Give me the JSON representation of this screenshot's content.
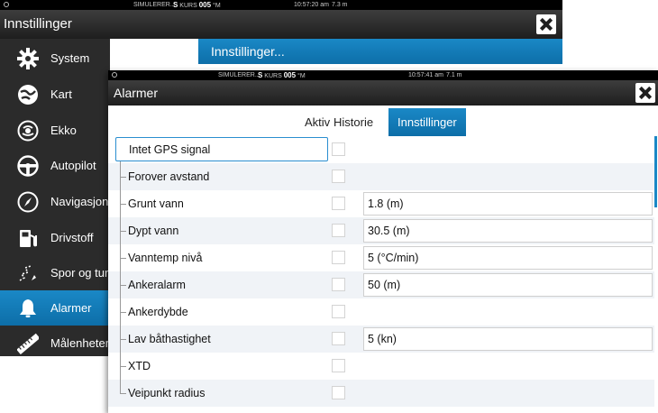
{
  "bg_window": {
    "status": {
      "mode": "SIMULERER...",
      "heading": "S",
      "kurs_label": "KURS",
      "kurs_value": "005",
      "unit": "°M",
      "time": "10:57:20 am",
      "depth": "7.3 m"
    },
    "title": "Innstillinger",
    "right_panel_title": "Innstillinger...",
    "sidebar": [
      {
        "label": "System",
        "icon": "gear-icon",
        "active": false
      },
      {
        "label": "Kart",
        "icon": "chart-icon",
        "active": false
      },
      {
        "label": "Ekko",
        "icon": "echo-icon",
        "active": false
      },
      {
        "label": "Autopilot",
        "icon": "steering-wheel-icon",
        "active": false
      },
      {
        "label": "Navigasjon",
        "icon": "compass-icon",
        "active": false
      },
      {
        "label": "Drivstoff",
        "icon": "fuel-pump-icon",
        "active": false
      },
      {
        "label": "Spor og turer",
        "icon": "trail-icon",
        "active": false
      },
      {
        "label": "Alarmer",
        "icon": "bell-icon",
        "active": true
      },
      {
        "label": "Målenheter",
        "icon": "ruler-icon",
        "active": false
      }
    ]
  },
  "fg_window": {
    "status": {
      "mode": "SIMULERER...",
      "heading": "S",
      "kurs_label": "KURS",
      "kurs_value": "005",
      "unit": "°M",
      "time": "10:57:41 am",
      "depth": "7.1 m"
    },
    "title": "Alarmer",
    "tabs": [
      {
        "label": "Aktiv",
        "active": false
      },
      {
        "label": "Historie",
        "active": false
      },
      {
        "label": "Innstillinger",
        "active": true
      }
    ],
    "alarms": [
      {
        "name": "Intet GPS signal",
        "value": null
      },
      {
        "name": "Forover avstand",
        "value": null
      },
      {
        "name": "Grunt vann",
        "value": "1.8 (m)"
      },
      {
        "name": "Dypt vann",
        "value": "30.5 (m)"
      },
      {
        "name": "Vanntemp nivå",
        "value": "5 (°C/min)"
      },
      {
        "name": "Ankeralarm",
        "value": "50 (m)"
      },
      {
        "name": "Ankerdybde",
        "value": null
      },
      {
        "name": "Lav båthastighet",
        "value": "5 (kn)"
      },
      {
        "name": "XTD",
        "value": null
      },
      {
        "name": "Veipunkt radius",
        "value": null
      }
    ]
  },
  "colors": {
    "accent": "#1a88c6",
    "titlebar": "#2b2b2b",
    "sidebar": "#2b2b2b"
  }
}
